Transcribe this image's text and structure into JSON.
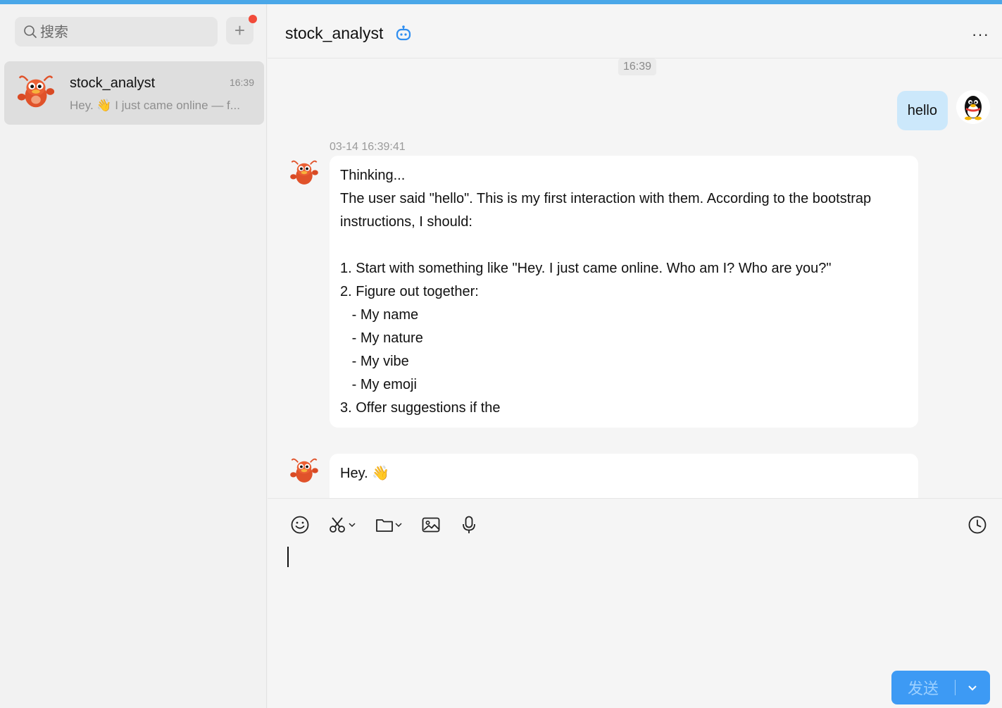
{
  "sidebar": {
    "search_placeholder": "搜索",
    "add_button": "+",
    "conversations": [
      {
        "name": "stock_analyst",
        "time": "16:39",
        "preview": "Hey. 👋 I just came online — f..."
      }
    ]
  },
  "header": {
    "title": "stock_analyst",
    "more": "···"
  },
  "messages": {
    "center_time": "16:39",
    "user_text": "hello",
    "bot_time": "03-14 16:39:41",
    "thinking_lines": [
      "Thinking...",
      "The user said \"hello\". This is my first interaction with them. According to the bootstrap instructions, I should:",
      "",
      "1. Start with something like \"Hey. I just came online. Who am I? Who are you?\"",
      "2. Figure out together:",
      "   - My name",
      "   - My nature",
      "   - My vibe",
      "   - My emoji",
      "3. Offer suggestions if the"
    ],
    "reply_text": "Hey. 👋"
  },
  "composer": {
    "send_label": "发送"
  },
  "colors": {
    "accent": "#3d9af4",
    "topbar": "#4aa7e8",
    "user_bubble": "#cce8fb",
    "notification": "#f24b3a"
  }
}
